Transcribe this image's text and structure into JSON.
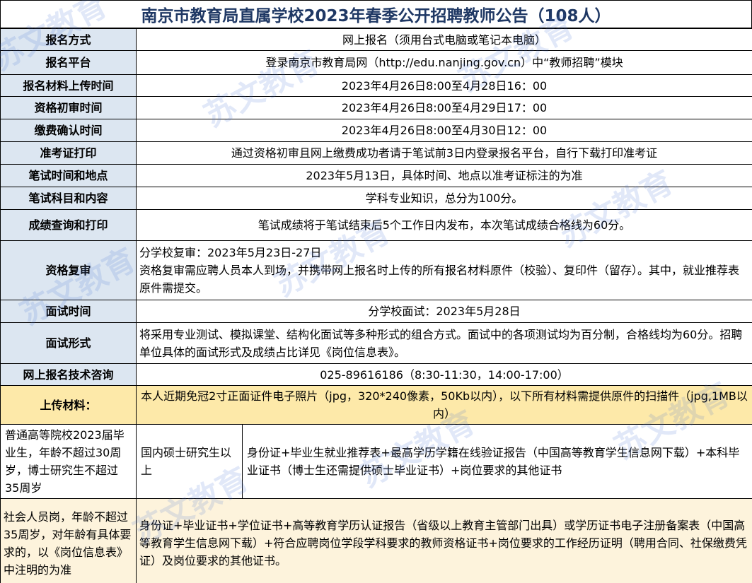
{
  "title": "南京市教育局直属学校2023年春季公开招聘教师公告（108人）",
  "watermark_text": "苏文教育",
  "rows": [
    {
      "label": "报名方式",
      "value": "网上报名（须用台式电脑或笔记本电脑）"
    },
    {
      "label": "报名平台",
      "value": "登录南京市教育局网（http://edu.nanjing.gov.cn）中“教师招聘”模块"
    },
    {
      "label": "报名材料上传时间",
      "value": "2023年4月26日8:00至4月28日16：00"
    },
    {
      "label": "资格初审时间",
      "value": "2023年4月26日8:00至4月29日17：00"
    },
    {
      "label": "缴费确认时间",
      "value": "2023年4月26日8:00至4月30日12：00"
    },
    {
      "label": "准考证打印",
      "value": "通过资格初审且网上缴费成功者请于笔试前3日内登录报名平台，自行下载打印准考证"
    },
    {
      "label": "笔试时间和地点",
      "value": "2023年5月13日，具体时间、地点以准考证标注的为准"
    },
    {
      "label": "笔试科目和内容",
      "value": "学科专业知识，总分为100分。"
    },
    {
      "label": "成绩查询和打印",
      "value": "笔试成绩将于笔试结束后5个工作日内发布，本次笔试成绩合格线为60分。"
    },
    {
      "label": "资格复审",
      "value_line1": "分学校复审：2023年5月23日-27日",
      "value_line2": "资格复审需应聘人员本人到场，并携带网上报名时上传的所有报名材料原件（校验）、复印件（留存）。其中，就业推荐表原件需提交。"
    },
    {
      "label": "面试时间",
      "value": "分学校面试：2023年5月28日"
    },
    {
      "label": "面试形式",
      "value": "将采用专业测试、模拟课堂、结构化面试等多种形式的组合方式。面试中的各项测试均为百分制，合格线均为60分。招聘单位具体的面试形式及成绩占比详见《岗位信息表》。"
    },
    {
      "label": "网上报名技术咨询",
      "value": "025-89616186（8:30-11:30，14:00-17:00）"
    }
  ],
  "upload": {
    "label": "上传材料：",
    "value": "本人近期免冠2寸正面证件电子照片（jpg，320*240像素，50Kb以内），以下所有材料需提供原件的扫描件（jpg,1MB以内）"
  },
  "graduates": {
    "category": "普通高等院校2023届毕业生，年龄不超过30周岁，博士研究生不超过35周岁",
    "level": "国内硕士研究生以上",
    "materials": "身份证+毕业生就业推荐表+最高学历学籍在线验证报告（中国高等教育学生信息网下载）+本科毕业证书（博士生还需提供硕士毕业证书）+岗位要求的其他证书"
  },
  "social": {
    "category": "社会人员岗，年龄不超过35周岁，对年龄有具体要求的，以《岗位信息表》中注明的为准",
    "materials": "身份证+毕业证书+学位证书+高等教育学历认证报告（省级以上教育主管部门出具）或学历证书电子注册备案表（中国高等教育学生信息网下载）+符合应聘岗位学段学科要求的教师资格证书+岗位要求的工作经历证明（聘用合同、社保缴费凭证）及岗位要求的其他证书。"
  },
  "colors": {
    "title": "#1f3864",
    "label_bg": "#dce6f1",
    "upload_bg": "#fde9a9",
    "pale_bg": "#fdf3dc",
    "watermark": "#466ed2"
  }
}
